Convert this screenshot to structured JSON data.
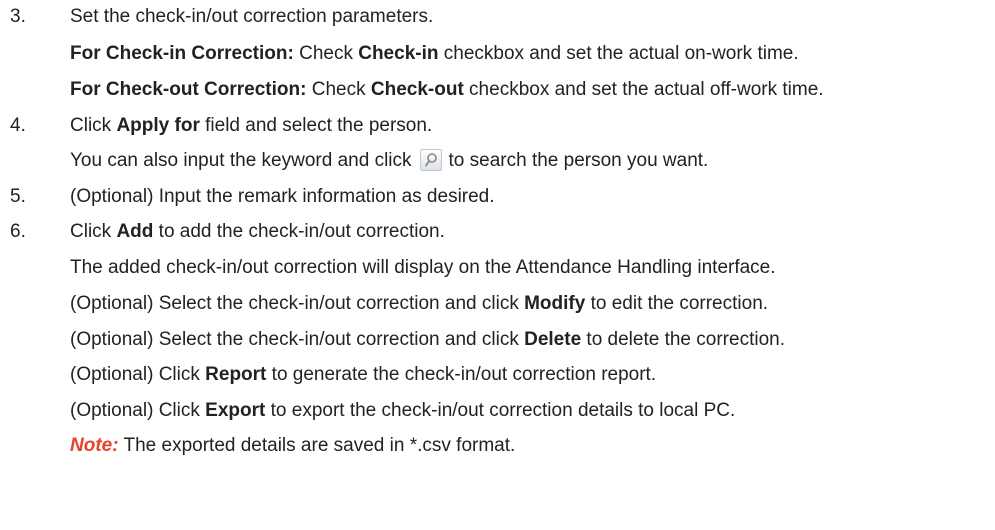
{
  "steps": [
    {
      "number": "3.",
      "text": "Set the check-in/out correction parameters.",
      "sub": [
        {
          "bold": "For Check-in Correction:",
          "t1": " Check ",
          "bold2": "Check-in",
          "t2": " checkbox and set the actual on-work time."
        },
        {
          "bold": "For Check-out Correction:",
          "t1": " Check ",
          "bold2": "Check-out",
          "t2": " checkbox and set the actual off-work time."
        }
      ]
    },
    {
      "number": "4.",
      "t1": "Click ",
      "bold": "Apply for",
      "t2": " field and select the person.",
      "sub_before": "You can also input the keyword and click",
      "sub_after": "to search the person you want."
    },
    {
      "number": "5.",
      "text": "(Optional) Input the remark information as desired."
    },
    {
      "number": "6.",
      "t1": "Click ",
      "bold": "Add",
      "t2": " to add the check-in/out correction.",
      "sub": [
        {
          "text": "The added check-in/out correction will display on the Attendance Handling interface."
        },
        {
          "t1": "(Optional) Select the check-in/out correction and click ",
          "bold": "Modify",
          "t2": " to edit the correction."
        },
        {
          "t1": "(Optional) Select the check-in/out correction and click ",
          "bold": "Delete",
          "t2": " to delete the correction."
        },
        {
          "t1": "(Optional) Click ",
          "bold": "Report",
          "t2": " to generate the check-in/out correction report."
        },
        {
          "t1": "(Optional) Click ",
          "bold": "Export",
          "t2": " to export the check-in/out correction details to local PC."
        }
      ]
    }
  ],
  "note": {
    "label": "Note:",
    "text": " The exported details are saved in *.csv format."
  },
  "icons": {
    "search": "search-icon"
  },
  "colors": {
    "text": "#222222",
    "note_label": "#e8412c"
  }
}
